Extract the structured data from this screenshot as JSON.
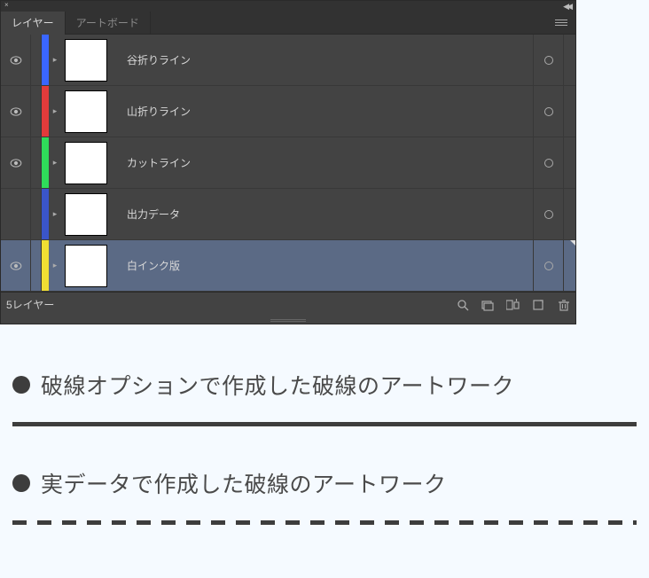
{
  "tabs": {
    "layers": "レイヤー",
    "artboards": "アートボード"
  },
  "layers": [
    {
      "name": "谷折りライン",
      "color": "#3a66ff",
      "visible": true,
      "selected": false
    },
    {
      "name": "山折りライン",
      "color": "#e23b3b",
      "visible": true,
      "selected": false
    },
    {
      "name": "カットライン",
      "color": "#2fdc5a",
      "visible": true,
      "selected": false
    },
    {
      "name": "出力データ",
      "color": "#3a55c9",
      "visible": false,
      "selected": false
    },
    {
      "name": "白インク版",
      "color": "#f0de33",
      "visible": true,
      "selected": true
    }
  ],
  "footer": {
    "count": "5レイヤー"
  },
  "notes": {
    "bullet1": "破線オプションで作成した破線のアートワーク",
    "bullet2": "実データで作成した破線のアートワーク"
  }
}
